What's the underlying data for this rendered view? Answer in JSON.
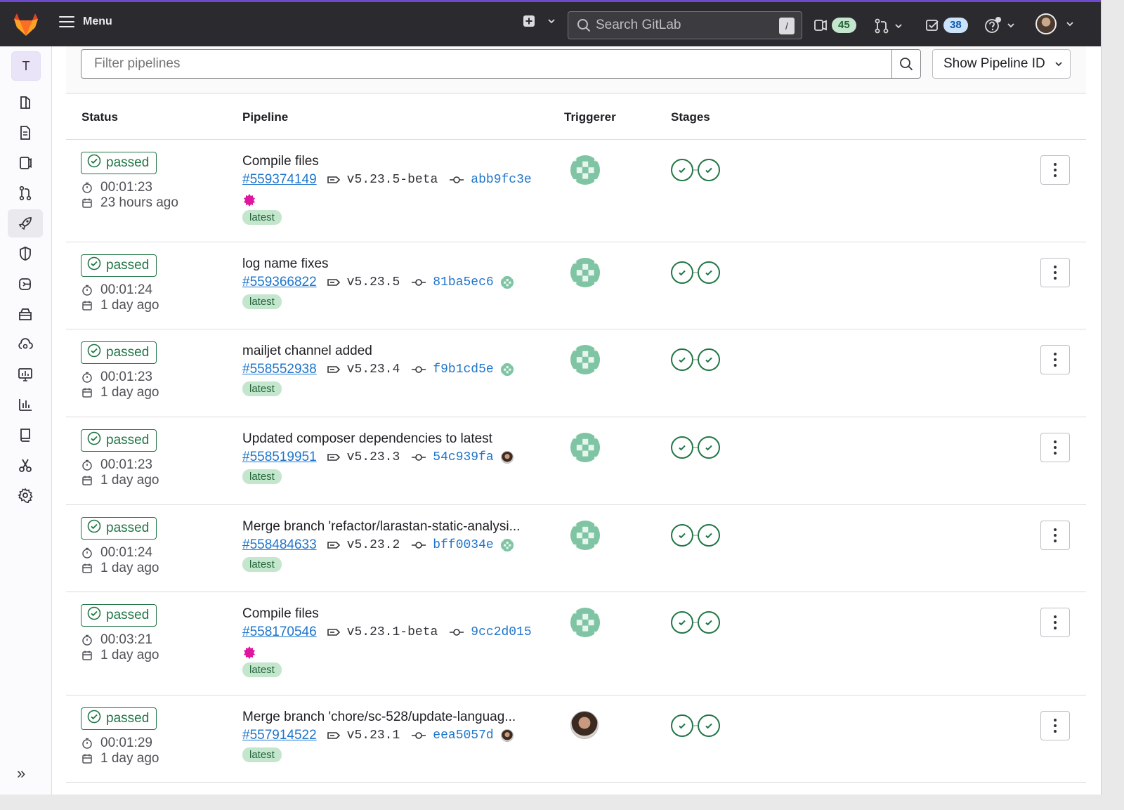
{
  "topbar": {
    "menu_label": "Menu",
    "search_placeholder": "Search GitLab",
    "search_shortcut": "/",
    "issues_count": "45",
    "todos_count": "38",
    "icons": [
      "gitlab-logo",
      "hamburger-icon",
      "plus-square-icon",
      "chevron-down-icon",
      "search-icon",
      "issues-icon",
      "merge-request-icon",
      "todo-icon",
      "help-icon",
      "user-avatar"
    ]
  },
  "sidebar": {
    "project_initial": "T",
    "items": [
      {
        "name": "project-overview-icon"
      },
      {
        "name": "repository-icon"
      },
      {
        "name": "issues-icon"
      },
      {
        "name": "merge-requests-icon"
      },
      {
        "name": "ci-cd-rocket-icon",
        "active": true
      },
      {
        "name": "security-shield-icon"
      },
      {
        "name": "deployments-icon"
      },
      {
        "name": "packages-icon"
      },
      {
        "name": "infrastructure-icon"
      },
      {
        "name": "monitor-icon"
      },
      {
        "name": "analytics-icon"
      },
      {
        "name": "wiki-icon"
      },
      {
        "name": "snippets-icon"
      },
      {
        "name": "settings-gear-icon"
      }
    ],
    "collapse_label": "»"
  },
  "filter": {
    "placeholder": "Filter pipelines",
    "dropdown_label": "Show Pipeline ID"
  },
  "table": {
    "headers": {
      "status": "Status",
      "pipeline": "Pipeline",
      "triggerer": "Triggerer",
      "stages": "Stages"
    },
    "rows": [
      {
        "status": "passed",
        "duration": "00:01:23",
        "finished": "23 hours ago",
        "title": "Compile files",
        "id": "#559374149",
        "ref": "v5.23.5-beta",
        "sha": "abb9fc3e",
        "badge": "latest",
        "author_avatar": "pink",
        "triggerer": "identicon"
      },
      {
        "status": "passed",
        "duration": "00:01:24",
        "finished": "1 day ago",
        "title": "log name fixes",
        "id": "#559366822",
        "ref": "v5.23.5",
        "sha": "81ba5ec6",
        "badge": "latest",
        "author_avatar": "green",
        "triggerer": "identicon"
      },
      {
        "status": "passed",
        "duration": "00:01:23",
        "finished": "1 day ago",
        "title": "mailjet channel added",
        "id": "#558552938",
        "ref": "v5.23.4",
        "sha": "f9b1cd5e",
        "badge": "latest",
        "author_avatar": "green",
        "triggerer": "identicon"
      },
      {
        "status": "passed",
        "duration": "00:01:23",
        "finished": "1 day ago",
        "title": "Updated composer dependencies to latest",
        "id": "#558519951",
        "ref": "v5.23.3",
        "sha": "54c939fa",
        "badge": "latest",
        "author_avatar": "photo",
        "triggerer": "identicon"
      },
      {
        "status": "passed",
        "duration": "00:01:24",
        "finished": "1 day ago",
        "title": "Merge branch 'refactor/larastan-static-analysi...",
        "id": "#558484633",
        "ref": "v5.23.2",
        "sha": "bff0034e",
        "badge": "latest",
        "author_avatar": "green",
        "triggerer": "identicon"
      },
      {
        "status": "passed",
        "duration": "00:03:21",
        "finished": "1 day ago",
        "title": "Compile files",
        "id": "#558170546",
        "ref": "v5.23.1-beta",
        "sha": "9cc2d015",
        "badge": "latest",
        "author_avatar": "pink",
        "triggerer": "identicon"
      },
      {
        "status": "passed",
        "duration": "00:01:29",
        "finished": "1 day ago",
        "title": "Merge branch 'chore/sc-528/update-languag...",
        "id": "#557914522",
        "ref": "v5.23.1",
        "sha": "eea5057d",
        "badge": "latest",
        "author_avatar": "photo",
        "triggerer": "photo"
      }
    ]
  },
  "colors": {
    "topbar_bg": "#2b2a2e",
    "success_green": "#217645",
    "link_blue": "#1f75cb",
    "badge_green_bg": "#c3e6cd",
    "identicon_green": "#7fc4a3",
    "pink_avatar": "#e0169f"
  }
}
